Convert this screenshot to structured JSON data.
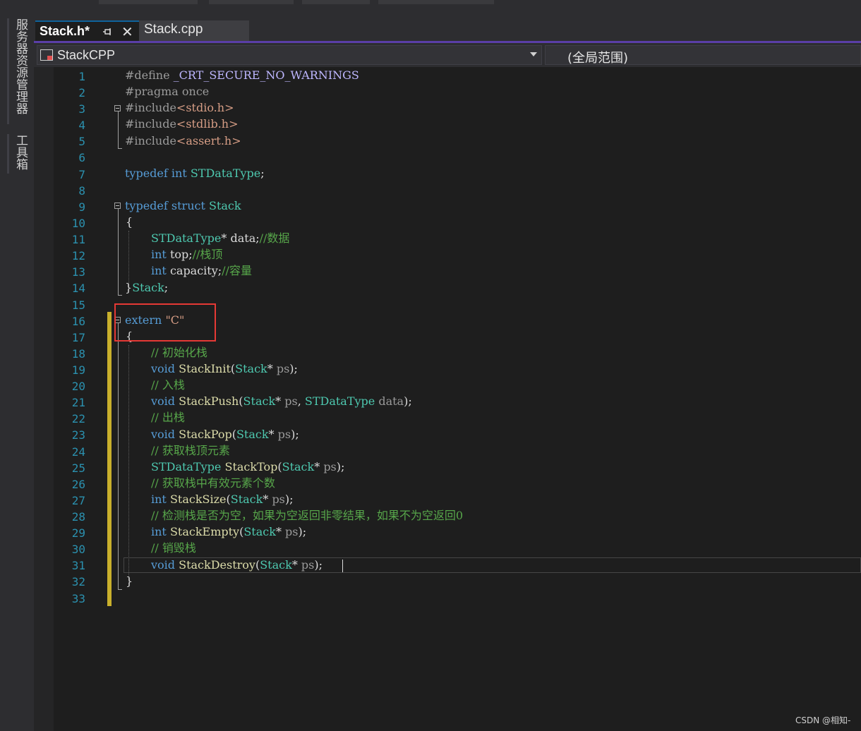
{
  "left_panel": {
    "tabs": [
      "服务器资源管理器",
      "工具箱"
    ]
  },
  "tabs": [
    {
      "label": "Stack.h*",
      "active": true
    },
    {
      "label": "Stack.cpp",
      "active": false
    }
  ],
  "navbar": {
    "project": "StackCPP",
    "scope": "(全局范围)"
  },
  "editor": {
    "line_numbers": [
      "1",
      "2",
      "3",
      "4",
      "5",
      "6",
      "7",
      "8",
      "9",
      "10",
      "11",
      "12",
      "13",
      "14",
      "15",
      "16",
      "17",
      "18",
      "19",
      "20",
      "21",
      "22",
      "23",
      "24",
      "25",
      "26",
      "27",
      "28",
      "29",
      "30",
      "31",
      "32",
      "33"
    ],
    "code": {
      "l1_a": "#define ",
      "l1_b": "_CRT_SECURE_NO_WARNINGS",
      "l2_a": "#pragma ",
      "l2_b": "once",
      "l3_a": "#include",
      "l3_b": "<stdio.h>",
      "l4_a": "#include",
      "l4_b": "<stdlib.h>",
      "l5_a": "#include",
      "l5_b": "<assert.h>",
      "l7_a": "typedef ",
      "l7_b": "int ",
      "l7_c": "STDataType",
      "l7_d": ";",
      "l9_a": "typedef ",
      "l9_b": "struct ",
      "l9_c": "Stack",
      "l10": "{",
      "l11_a": "STDataType",
      "l11_b": "* ",
      "l11_c": "data",
      "l11_d": ";",
      "l11_e": "//数据",
      "l12_a": "int ",
      "l12_b": "top",
      "l12_c": ";",
      "l12_d": "//栈顶",
      "l13_a": "int ",
      "l13_b": "capacity",
      "l13_c": ";",
      "l13_d": "//容量",
      "l14_a": "}",
      "l14_b": "Stack",
      "l14_c": ";",
      "l16_a": "extern ",
      "l16_b": "\"C\"",
      "l17": "{",
      "l18": "// 初始化栈",
      "l19_a": "void ",
      "l19_b": "StackInit",
      "l19_c": "(",
      "l19_d": "Stack",
      "l19_e": "* ",
      "l19_f": "ps",
      "l19_g": ");",
      "l20": "// 入栈",
      "l21_a": "void ",
      "l21_b": "StackPush",
      "l21_c": "(",
      "l21_d": "Stack",
      "l21_e": "* ",
      "l21_f": "ps",
      "l21_g": ", ",
      "l21_h": "STDataType ",
      "l21_i": "data",
      "l21_j": ");",
      "l22": "// 出栈",
      "l23_a": "void ",
      "l23_b": "StackPop",
      "l23_c": "(",
      "l23_d": "Stack",
      "l23_e": "* ",
      "l23_f": "ps",
      "l23_g": ");",
      "l24": "// 获取栈顶元素",
      "l25_a": "STDataType ",
      "l25_b": "StackTop",
      "l25_c": "(",
      "l25_d": "Stack",
      "l25_e": "* ",
      "l25_f": "ps",
      "l25_g": ");",
      "l26": "// 获取栈中有效元素个数",
      "l27_a": "int ",
      "l27_b": "StackSize",
      "l27_c": "(",
      "l27_d": "Stack",
      "l27_e": "* ",
      "l27_f": "ps",
      "l27_g": ");",
      "l28": "// 检测栈是否为空，如果为空返回非零结果，如果不为空返回0",
      "l29_a": "int ",
      "l29_b": "StackEmpty",
      "l29_c": "(",
      "l29_d": "Stack",
      "l29_e": "* ",
      "l29_f": "ps",
      "l29_g": ");",
      "l30": "// 销毁栈",
      "l31_a": "void ",
      "l31_b": "StackDestroy",
      "l31_c": "(",
      "l31_d": "Stack",
      "l31_e": "* ",
      "l31_f": "ps",
      "l31_g": ");",
      "l32": "}"
    }
  },
  "watermark": "CSDN @相知-",
  "colors": {
    "keyword": "#569cd6",
    "type": "#4ec9b0",
    "string": "#d69d85",
    "comment": "#57a64a",
    "function": "#dcdcaa",
    "line_number": "#2b91af",
    "highlight_box": "#e53935",
    "change_bar": "#c9b02c"
  }
}
